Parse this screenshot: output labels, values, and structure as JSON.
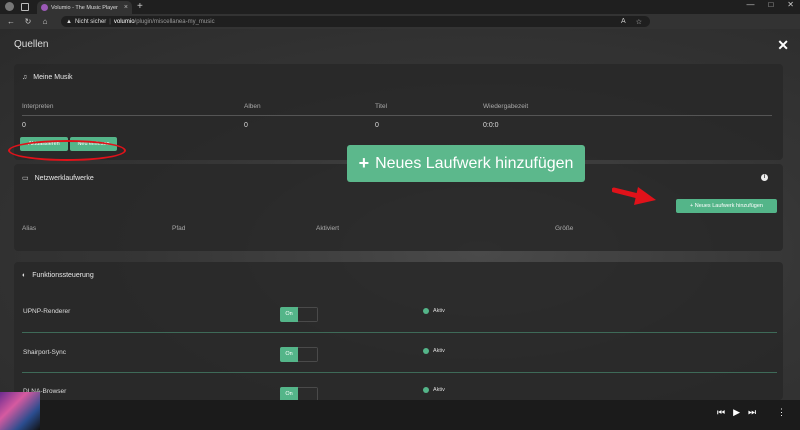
{
  "browser": {
    "tab_title": "Volumio - The Music Player",
    "tab_close": "×",
    "new_tab": "+",
    "url_warning": "Nicht sicher",
    "url_host": "volumio",
    "url_path": "/plugin/miscellanea-my_music",
    "win_minimize": "—",
    "win_maximize": "□",
    "win_close": "✕"
  },
  "page": {
    "title": "Quellen",
    "close": "✕"
  },
  "my_music": {
    "title": "Meine Musik",
    "columns": [
      "Interpreten",
      "Alben",
      "Titel",
      "Wiedergabezeit"
    ],
    "values": [
      "0",
      "0",
      "0",
      "0:0:0"
    ],
    "update_button": "Aktualisieren",
    "rescan_button": "Neu einlesen"
  },
  "network": {
    "title": "Netzwerklaufwerke",
    "add_button_large": "Neues Laufwerk hinzufügen",
    "add_button_small": "+ Neues Laufwerk hinzufügen",
    "columns": [
      "Alias",
      "Pfad",
      "Aktiviert",
      "Größe"
    ],
    "info_icon": "i"
  },
  "functions": {
    "title": "Funktionssteuerung",
    "items": [
      {
        "label": "UPNP-Renderer",
        "toggle": "On",
        "status": "Aktiv"
      },
      {
        "label": "Shairport-Sync",
        "toggle": "On",
        "status": "Aktiv"
      },
      {
        "label": "DLNA-Browser",
        "toggle": "On",
        "status": "Aktiv"
      }
    ]
  },
  "player": {
    "prev": "⏮",
    "play": "▶",
    "next": "⏭",
    "menu": "⋮"
  },
  "colors": {
    "accent_green": "#54b589",
    "highlight_red": "#e0121a"
  }
}
